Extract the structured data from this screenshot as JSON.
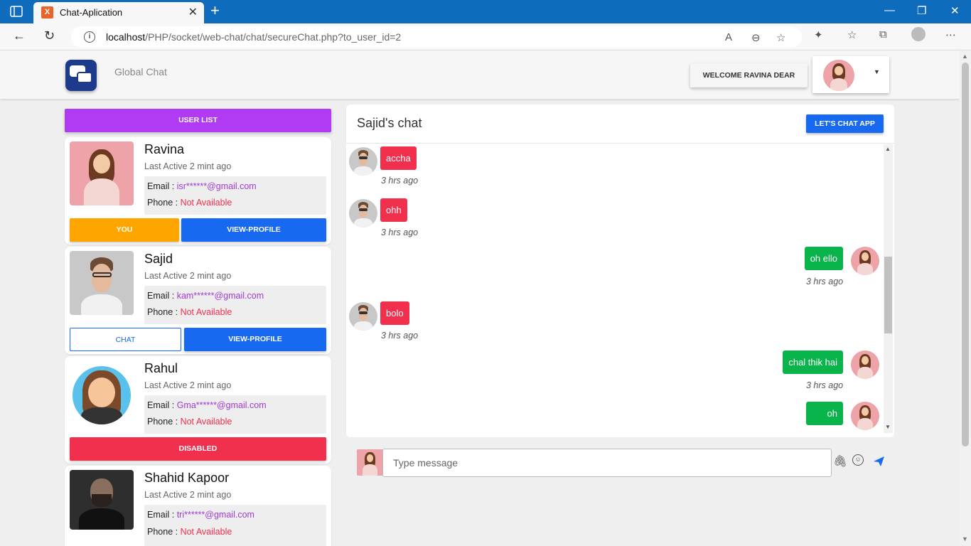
{
  "browser": {
    "tab_title": "Chat-Aplication",
    "tab_favicon": "xampp-icon",
    "url_host": "localhost",
    "url_path": "/PHP/socket/web-chat/chat/secureChat.php?to_user_id=2"
  },
  "header": {
    "brand": "Global Chat",
    "welcome": "WELCOME RAVINA DEAR"
  },
  "sidebar": {
    "user_list_label": "USER LIST",
    "email_label": "Email : ",
    "phone_label": "Phone : ",
    "users": [
      {
        "name": "Ravina",
        "last_active": "Last Active 2 mint ago",
        "email": "isr******@gmail.com",
        "phone": "Not Available",
        "btn_left": "YOU",
        "btn_right": "VIEW-PROFILE"
      },
      {
        "name": "Sajid",
        "last_active": "Last Active 2 mint ago",
        "email": "kam******@gmail.com",
        "phone": "Not Available",
        "btn_left": "CHAT",
        "btn_right": "VIEW-PROFILE"
      },
      {
        "name": "Rahul",
        "last_active": "Last Active 2 mint ago",
        "email": "Gma******@gmail.com",
        "phone": "Not Available",
        "btn_full": "DISABLED"
      },
      {
        "name": "Shahid Kapoor",
        "last_active": "Last Active 2 mint ago",
        "email": "tri******@gmail.com",
        "phone": "Not Available"
      }
    ]
  },
  "chat": {
    "title": "Sajid's chat",
    "app_button": "LET'S CHAT APP",
    "messages": [
      {
        "side": "in",
        "text": "accha",
        "time": "3 hrs ago"
      },
      {
        "side": "in",
        "text": "ohh",
        "time": "3 hrs ago"
      },
      {
        "side": "out",
        "text": "oh ello",
        "time": "3 hrs ago"
      },
      {
        "side": "in",
        "text": "bolo",
        "time": "3 hrs ago"
      },
      {
        "side": "out",
        "text": "chal thik hai",
        "time": "3 hrs ago"
      },
      {
        "side": "out",
        "text": "oh",
        "time": ""
      }
    ],
    "composer_placeholder": "Type message"
  },
  "colors": {
    "brand_blue": "#0f6cbd",
    "purple": "#b03bf2",
    "blue": "#1769f0",
    "orange": "#ffa500",
    "red": "#f0304c",
    "green": "#09b44b"
  }
}
